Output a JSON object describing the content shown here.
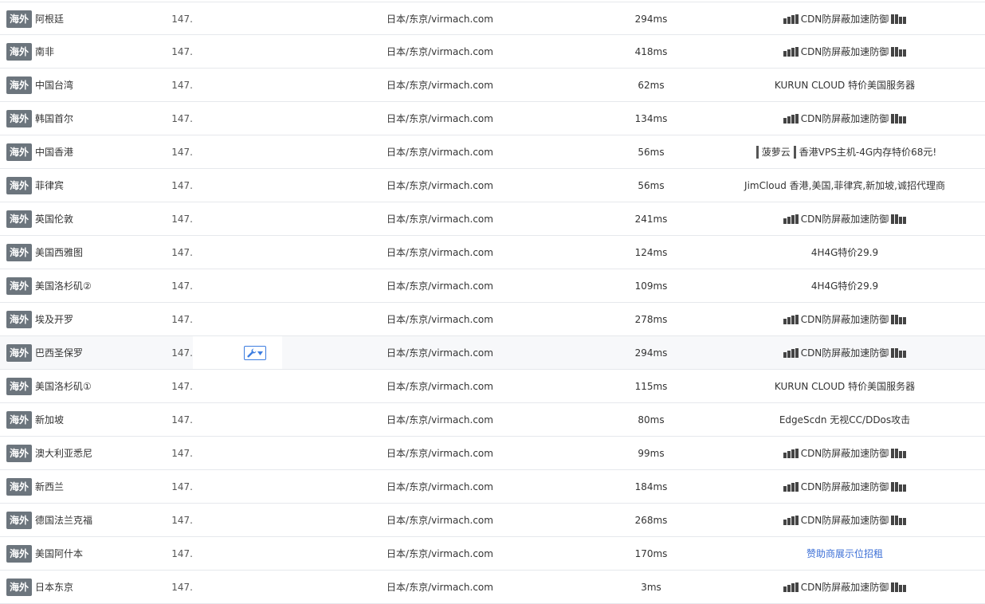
{
  "badge_label": "海外",
  "ip_prefix": "147.",
  "rows": [
    {
      "location": "阿根廷",
      "route": "日本/东京/virmach.com",
      "time": "294ms",
      "ad": "CDN防屏蔽加速防御",
      "ad_style": "cdn"
    },
    {
      "location": "南非",
      "route": "日本/东京/virmach.com",
      "time": "418ms",
      "ad": "CDN防屏蔽加速防御",
      "ad_style": "cdn"
    },
    {
      "location": "中国台湾",
      "route": "日本/东京/virmach.com",
      "time": "62ms",
      "ad": "KURUN CLOUD 特价美国服务器",
      "ad_style": "plain"
    },
    {
      "location": "韩国首尔",
      "route": "日本/东京/virmach.com",
      "time": "134ms",
      "ad": "CDN防屏蔽加速防御",
      "ad_style": "cdn"
    },
    {
      "location": "中国香港",
      "route": "日本/东京/virmach.com",
      "time": "56ms",
      "ad": "菠萝云",
      "ad2": "香港VPS主机-4G内存特价68元!",
      "ad_style": "split"
    },
    {
      "location": "菲律宾",
      "route": "日本/东京/virmach.com",
      "time": "56ms",
      "ad": "JimCloud 香港,美国,菲律宾,新加坡,诚招代理商",
      "ad_style": "plain"
    },
    {
      "location": "英国伦敦",
      "route": "日本/东京/virmach.com",
      "time": "241ms",
      "ad": "CDN防屏蔽加速防御",
      "ad_style": "cdn"
    },
    {
      "location": "美国西雅图",
      "route": "日本/东京/virmach.com",
      "time": "124ms",
      "ad": "4H4G特价29.9",
      "ad_style": "plain"
    },
    {
      "location": "美国洛杉矶②",
      "route": "日本/东京/virmach.com",
      "time": "109ms",
      "ad": "4H4G特价29.9",
      "ad_style": "plain"
    },
    {
      "location": "埃及开罗",
      "route": "日本/东京/virmach.com",
      "time": "278ms",
      "ad": "CDN防屏蔽加速防御",
      "ad_style": "cdn"
    },
    {
      "location": "巴西圣保罗",
      "route": "日本/东京/virmach.com",
      "time": "294ms",
      "ad": "CDN防屏蔽加速防御",
      "ad_style": "cdn",
      "highlight": true
    },
    {
      "location": "美国洛杉矶①",
      "route": "日本/东京/virmach.com",
      "time": "115ms",
      "ad": "KURUN CLOUD 特价美国服务器",
      "ad_style": "plain"
    },
    {
      "location": "新加坡",
      "route": "日本/东京/virmach.com",
      "time": "80ms",
      "ad": "EdgeScdn 无视CC/DDos攻击",
      "ad_style": "plain"
    },
    {
      "location": "澳大利亚悉尼",
      "route": "日本/东京/virmach.com",
      "time": "99ms",
      "ad": "CDN防屏蔽加速防御",
      "ad_style": "cdn"
    },
    {
      "location": "新西兰",
      "route": "日本/东京/virmach.com",
      "time": "184ms",
      "ad": "CDN防屏蔽加速防御",
      "ad_style": "cdn"
    },
    {
      "location": "德国法兰克福",
      "route": "日本/东京/virmach.com",
      "time": "268ms",
      "ad": "CDN防屏蔽加速防御",
      "ad_style": "cdn"
    },
    {
      "location": "美国阿什本",
      "route": "日本/东京/virmach.com",
      "time": "170ms",
      "ad": "赞助商展示位招租",
      "ad_style": "link"
    },
    {
      "location": "日本东京",
      "route": "日本/东京/virmach.com",
      "time": "3ms",
      "ad": "CDN防屏蔽加速防御",
      "ad_style": "cdn"
    }
  ],
  "colors": {
    "badge_bg": "#6c757d",
    "link": "#3c6fd6",
    "tool_border": "#3c7de0",
    "row_border": "#e6e8ec",
    "highlight_bg": "#f7f8fa"
  },
  "icons": {
    "tool": "wrench-icon",
    "dropdown": "caret-down-icon"
  }
}
